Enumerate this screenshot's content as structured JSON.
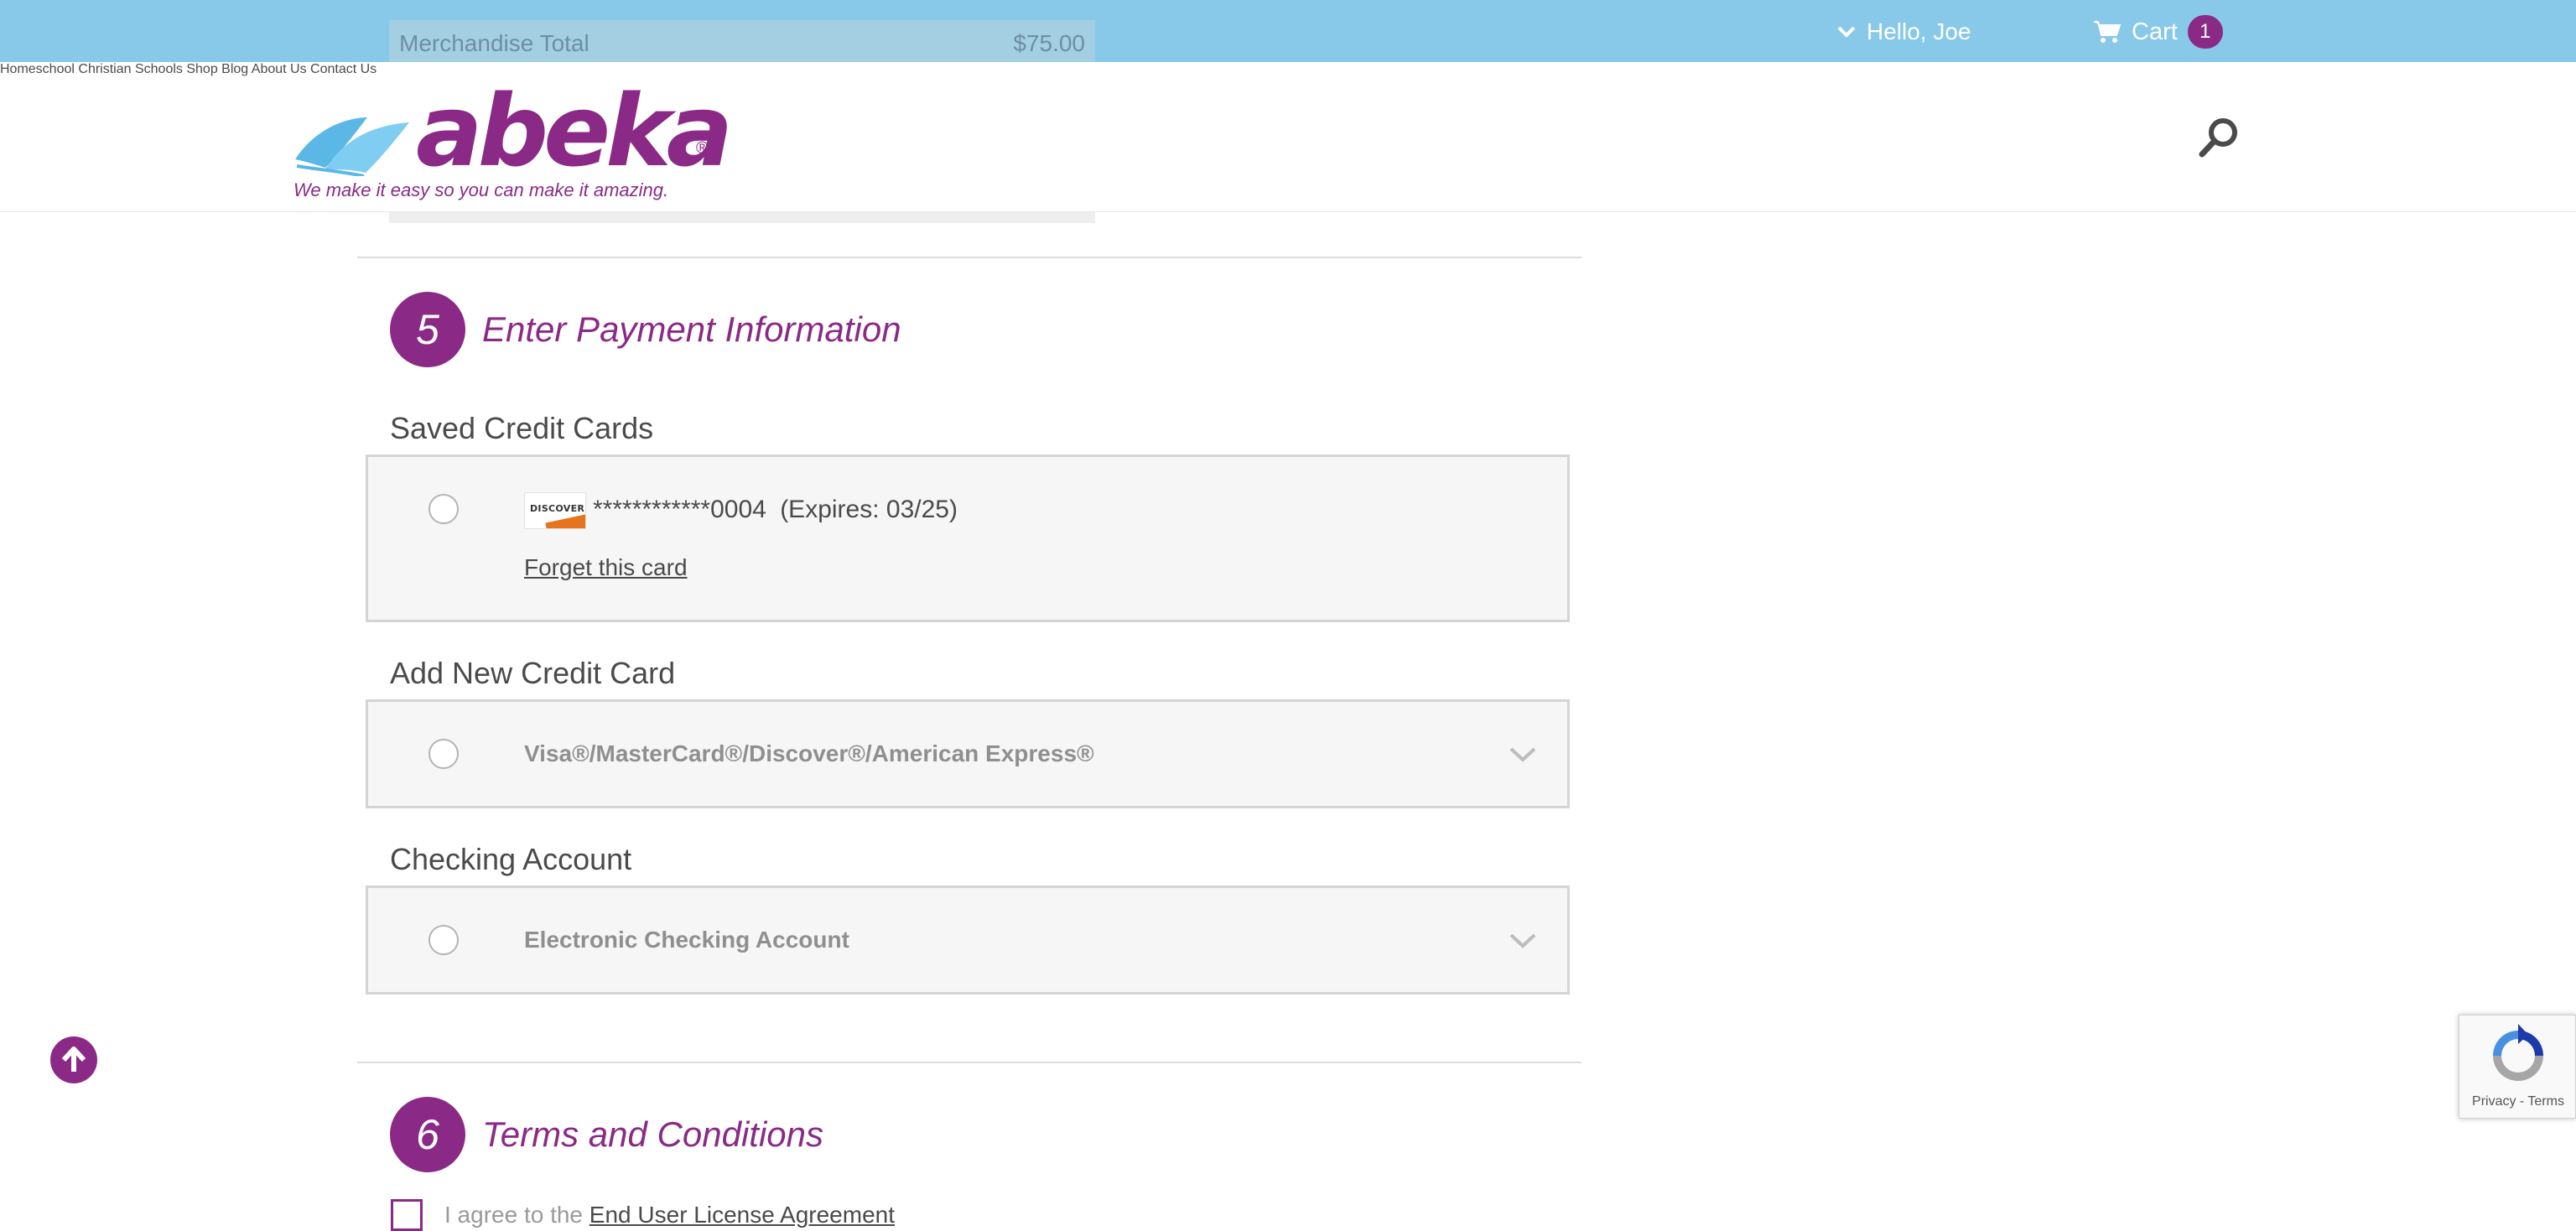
{
  "topbar": {
    "merchandise_label": "Merchandise Total",
    "merchandise_value": "$75.00",
    "greeting": "Hello, Joe",
    "cart_label": "Cart",
    "cart_count": "1"
  },
  "header": {
    "logo_text": "abeka",
    "logo_mark": "®",
    "tagline": "We make it easy so you can make it amazing.",
    "nav": [
      "Homeschool",
      "Christian Schools",
      "Shop",
      "Blog",
      "About Us",
      "Contact Us"
    ]
  },
  "payment": {
    "step_number": "5",
    "title": "Enter Payment Information",
    "saved_cards_label": "Saved Credit Cards",
    "saved_card": {
      "brand": "DISCOVER",
      "number": "************0004",
      "expires": "(Expires: 03/25)",
      "forget_link": "Forget this card"
    },
    "add_card_label": "Add New Credit Card",
    "add_card_option": "Visa®/MasterCard®/Discover®/American Express®",
    "checking_label": "Checking Account",
    "checking_option": "Electronic Checking Account"
  },
  "terms": {
    "step_number": "6",
    "title": "Terms and Conditions",
    "agree_text": "I agree to the",
    "agreement_link": "End User License Agreement"
  },
  "recaptcha": {
    "privacy": "Privacy",
    "separator": " - ",
    "terms": "Terms"
  },
  "colors": {
    "brand_purple": "#8a2a86",
    "topbar_blue": "#88c9ea",
    "logo_blue": "#5bb8e6"
  }
}
